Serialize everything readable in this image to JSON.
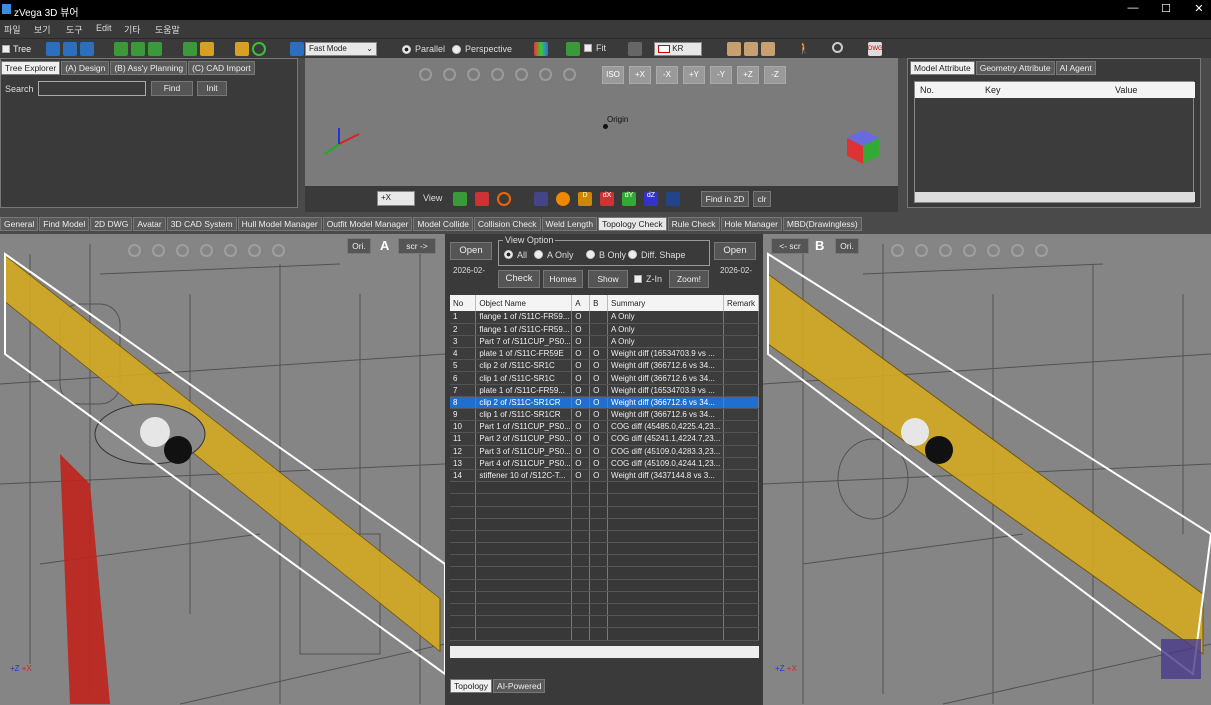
{
  "window": {
    "title": "zVega 3D 뷰어",
    "min": "—",
    "max": "☐",
    "close": "✕"
  },
  "menu": [
    "파일",
    "보기",
    "도구",
    "Edit",
    "기타",
    "도움말"
  ],
  "toolbar": {
    "tree_label": "Tree",
    "mode_select": "Fast Mode",
    "parallel_label": "Parallel",
    "perspective_label": "Perspective",
    "fit_label": "Fit",
    "lang_select": "KR"
  },
  "left_panel": {
    "tabs": [
      "Tree Explorer",
      "(A) Design",
      "(B) Ass'y Planning",
      "(C) CAD Import"
    ],
    "search_label": "Search",
    "search_value": "",
    "find_button": "Find",
    "init_button": "Init"
  },
  "top_viewport": {
    "view_buttons": [
      "ISO",
      "+X",
      "-X",
      "+Y",
      "-Y",
      "+Z",
      "-Z"
    ],
    "origin_label": "Origin",
    "bottom_select": "+X",
    "view_label": "View",
    "tool_labels": [
      "D",
      "dX",
      "dY",
      "dZ"
    ],
    "find2d_button": "Find in 2D",
    "clr_button": "clr"
  },
  "right_panel": {
    "tabs": [
      "Model Attribute",
      "Geometry Attribute",
      "AI Agent"
    ],
    "columns": [
      "No.",
      "Key",
      "Value"
    ]
  },
  "main_tabs": [
    "General",
    "Find Model",
    "2D DWG",
    "Avatar",
    "3D CAD System",
    "Hull Model Manager",
    "Outfit Model Manager",
    "Model Collide",
    "Collision Check",
    "Weld Length",
    "Topology Check",
    "Rule Check",
    "Hole Manager",
    "MBD(Drawingless)"
  ],
  "active_main_tab": "Topology Check",
  "viewport_a": {
    "ori_button": "Ori.",
    "label": "A",
    "scr_button": "scr ->"
  },
  "viewport_b": {
    "scr_button": "<- scr",
    "label": "B",
    "ori_button": "Ori."
  },
  "compare": {
    "open_a": "Open",
    "date_a": "2026-02-",
    "open_b": "Open",
    "date_b": "2026-02-",
    "view_option_title": "View Option",
    "options": [
      "All",
      "A Only",
      "B Only",
      "Diff. Shape"
    ],
    "check_button": "Check",
    "homes_button": "Homes",
    "show_button": "Show",
    "zin_label": "Z-In",
    "zoom_button": "Zoom!",
    "columns": [
      "No",
      "Object Name",
      "A",
      "B",
      "Summary",
      "Remark"
    ],
    "rows": [
      {
        "no": "1",
        "name": "flange 1 of /S11C-FR59...",
        "a": "O",
        "b": "",
        "summary": "A Only"
      },
      {
        "no": "2",
        "name": "flange 1 of /S11C-FR59...",
        "a": "O",
        "b": "",
        "summary": "A Only"
      },
      {
        "no": "3",
        "name": "Part 7 of /S11CUP_PS0...",
        "a": "O",
        "b": "",
        "summary": "A Only"
      },
      {
        "no": "4",
        "name": "plate 1 of /S11C-FR59E",
        "a": "O",
        "b": "O",
        "summary": "Weight diff (16534703.9 vs ..."
      },
      {
        "no": "5",
        "name": "clip 2 of /S11C-SR1C",
        "a": "O",
        "b": "O",
        "summary": "Weight diff (366712.6 vs 34..."
      },
      {
        "no": "6",
        "name": "clip 1 of /S11C-SR1C",
        "a": "O",
        "b": "O",
        "summary": "Weight diff (366712.6 vs 34..."
      },
      {
        "no": "7",
        "name": "plate 1 of /S11C-FR59...",
        "a": "O",
        "b": "O",
        "summary": "Weight diff (16534703.9 vs ..."
      },
      {
        "no": "8",
        "name": "clip 2 of /S11C-SR1CR",
        "a": "O",
        "b": "O",
        "summary": "Weight diff (366712.6 vs 34..."
      },
      {
        "no": "9",
        "name": "clip 1 of /S11C-SR1CR",
        "a": "O",
        "b": "O",
        "summary": "Weight diff (366712.6 vs 34..."
      },
      {
        "no": "10",
        "name": "Part 1 of /S11CUP_PS0...",
        "a": "O",
        "b": "O",
        "summary": "COG diff (45485.0,4225.4,23..."
      },
      {
        "no": "11",
        "name": "Part 2 of /S11CUP_PS0...",
        "a": "O",
        "b": "O",
        "summary": "COG diff (45241.1,4224.7,23..."
      },
      {
        "no": "12",
        "name": "Part 3 of /S11CUP_PS0...",
        "a": "O",
        "b": "O",
        "summary": "COG diff (45109.0,4283.3,23..."
      },
      {
        "no": "13",
        "name": "Part 4 of /S11CUP_PS0...",
        "a": "O",
        "b": "O",
        "summary": "COG diff (45109.0,4244.1,23..."
      },
      {
        "no": "14",
        "name": "stiffener 10 of /S12C-T...",
        "a": "O",
        "b": "O",
        "summary": "Weight diff (3437144.8 vs 3..."
      }
    ],
    "selected_row": "8",
    "bottom_tabs": [
      "Topology",
      "AI-Powered"
    ]
  },
  "axis": {
    "x": "+X",
    "y": "+Y",
    "z": "+Z"
  },
  "colors": {
    "plate": "#d4a922",
    "pipe": "#c0231c",
    "selection": "#1e6fd0",
    "viewport_bg": "#7b7b7b"
  }
}
